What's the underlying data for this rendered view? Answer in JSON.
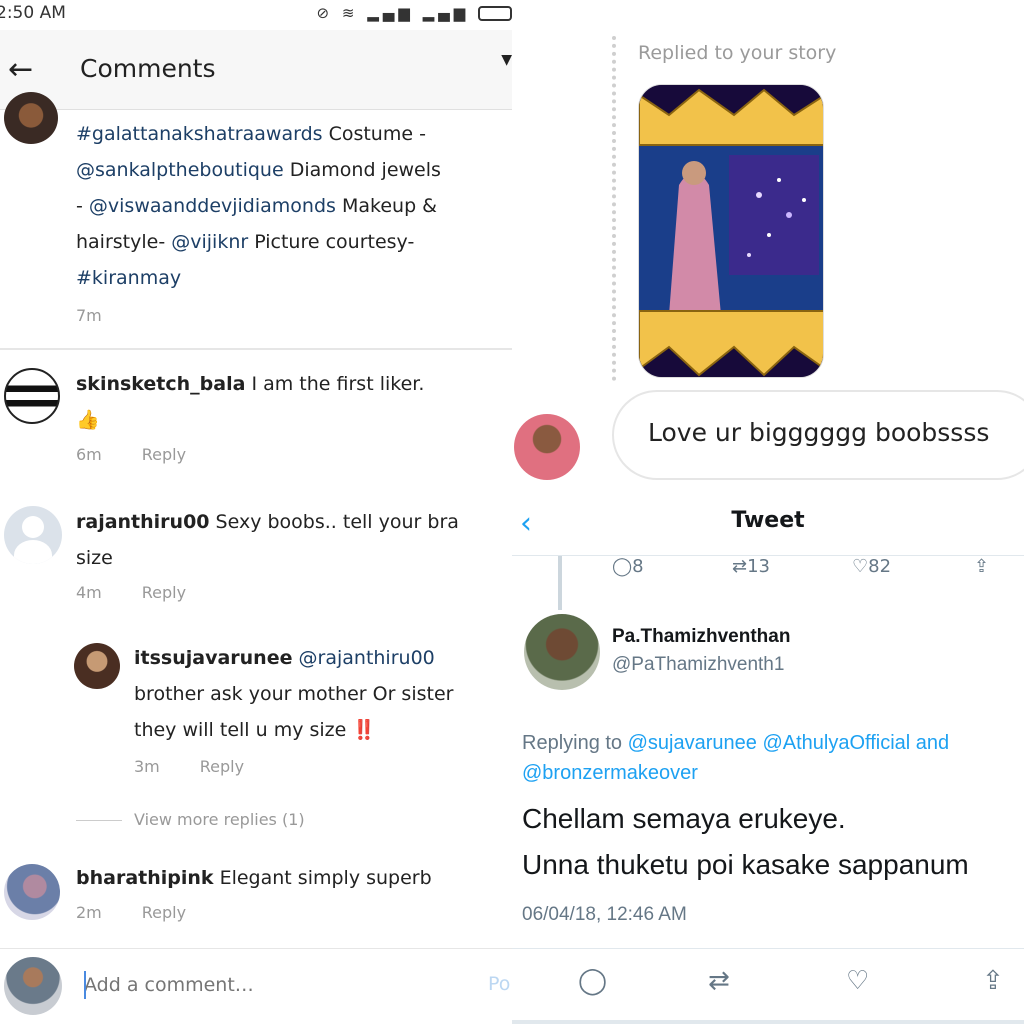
{
  "status": {
    "time": "2:50 AM"
  },
  "comments_header": {
    "title": "Comments"
  },
  "caption": {
    "line1_tag": "#galattanakshatraawards",
    "line1_rest": " Costume -",
    "line2_tag": "@sankalptheboutique",
    "line2_rest": " Diamond jewels",
    "line3_pre": "- ",
    "line3_tag": "@viswaanddevjidiamonds",
    "line3_rest": " Makeup &",
    "line4_pre": "hairstyle- ",
    "line4_tag": "@vijiknr",
    "line4_rest": "  Picture courtesy-",
    "line5_tag": "#kiranmay",
    "time": "7m"
  },
  "comments": [
    {
      "user": "skinsketch_bala",
      "text": " I am the first liker.",
      "emoji": "👍",
      "time": "6m",
      "reply": "Reply"
    },
    {
      "user": "rajanthiru00",
      "text": " Sexy boobs.. tell your bra",
      "text2": "size",
      "time": "4m",
      "reply": "Reply"
    },
    {
      "user": "itssujavarunee",
      "mention": " @rajanthiru00",
      "text": "brother ask your mother  Or sister",
      "text2": "they will tell u my size ",
      "emoji": "‼️",
      "time": "3m",
      "reply": "Reply"
    },
    {
      "user": "bharathipink",
      "text": " Elegant simply superb",
      "time": "2m",
      "reply": "Reply"
    }
  ],
  "view_more": "View more replies (1)",
  "add_comment": {
    "placeholder": "Add a comment…",
    "post": "Po"
  },
  "story": {
    "replied_label": "Replied to your story",
    "message": "Love ur bigggggg boobssss"
  },
  "tweet": {
    "header": "Tweet",
    "counts": {
      "replies": "8",
      "retweets": "13",
      "likes": "82"
    },
    "name": "Pa.Thamizhventhan",
    "handle": "@PaThamizhventh1",
    "replying_prefix": "Replying to ",
    "replying_links": "@sujavarunee @AthulyaOfficial",
    "replying_and": " and",
    "replying_link2": "@bronzermakeover",
    "body_line1": "Chellam semaya erukeye.",
    "body_line2": "Unna thuketu poi kasake sappanum",
    "date": "06/04/18, 12:46 AM"
  },
  "colors": {
    "twitter_blue": "#1da1f2",
    "ig_tag": "#1d3f66"
  }
}
